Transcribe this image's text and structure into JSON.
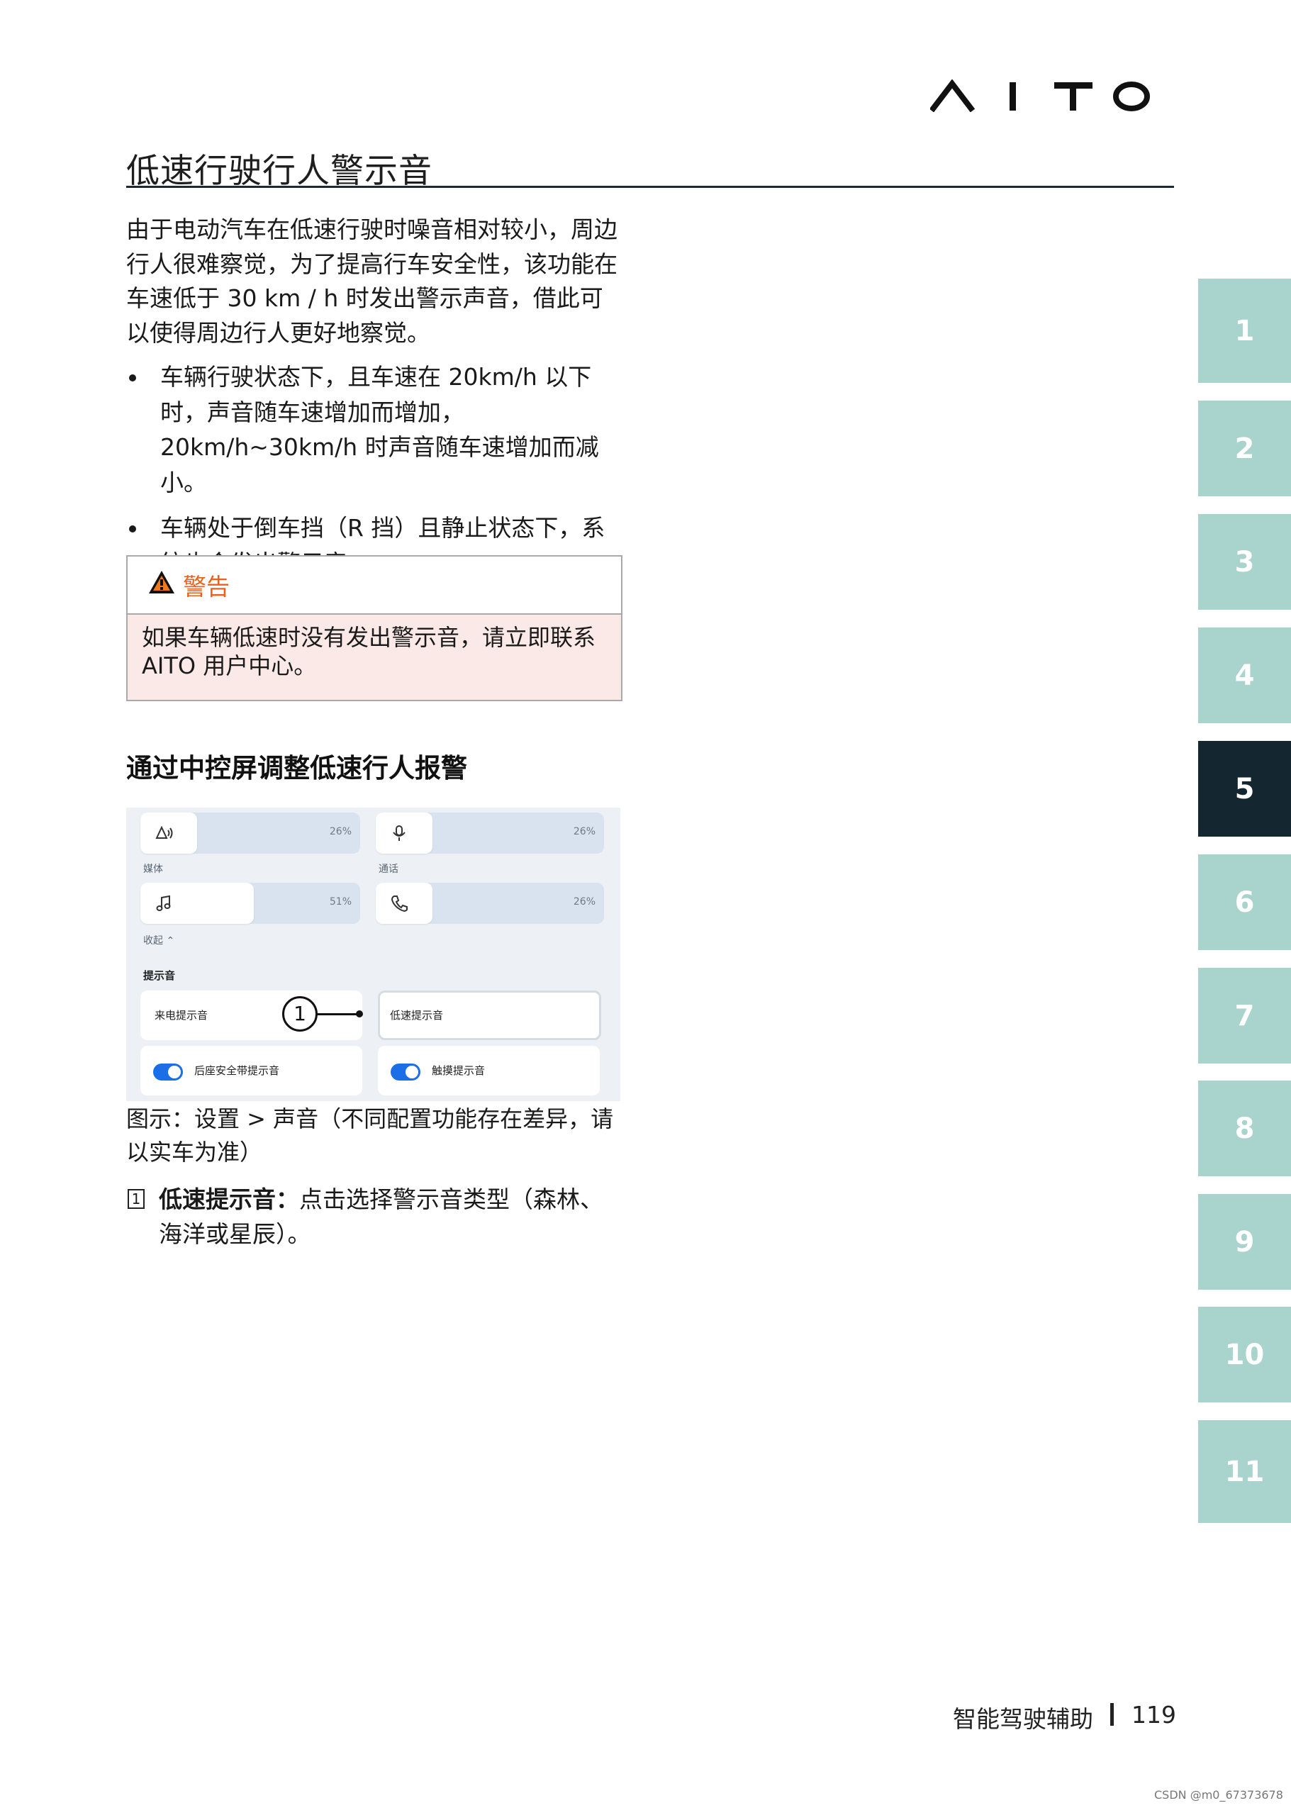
{
  "header": {
    "logo_text": "AITO",
    "title": "低速行驶行人警示音"
  },
  "intro": "由于电动汽车在低速行驶时噪音相对较小，周边行人很难察觉，为了提高行车安全性，该功能在车速低于 30 km / h 时发出警示声音，借此可以使得周边行人更好地察觉。",
  "bullets": [
    "车辆行驶状态下，且车速在 20km/h 以下时，声音随车速增加而增加，20km/h~30km/h 时声音随车速增加而减小。",
    "车辆处于倒车挡（R 挡）且静止状态下，系统也会发出警示音。"
  ],
  "warning": {
    "icon": "warning-triangle-icon",
    "title": "警告",
    "body": "如果车辆低速时没有发出警示音，请立即联系 AITO 用户中心。"
  },
  "subheading": "通过中控屏调整低速行人报警",
  "screenshot": {
    "sliders": [
      {
        "icon": "speaker-icon",
        "value": "26%"
      },
      {
        "icon": "microphone-icon",
        "value": "26%"
      },
      {
        "icon": "music-note-icon",
        "value": "51%"
      },
      {
        "icon": "phone-icon",
        "value": "26%"
      }
    ],
    "slider_fill": [
      0.26,
      0.26,
      0.51,
      0.26
    ],
    "label_media": "媒体",
    "label_call": "通话",
    "collapse": "收起",
    "section": "提示音",
    "card_incoming": "来电提示音",
    "card_lowspeed": "低速提示音",
    "toggle_rear_belt": "后座安全带提示音",
    "toggle_touch": "触摸提示音",
    "callout": "1"
  },
  "caption": "图示：设置 > 声音（不同配置功能存在差异，请以实车为准）",
  "numbered": {
    "num": "1",
    "term": "低速提示音：",
    "text": "点击选择警示音类型（森林、海洋或星辰）。"
  },
  "tabs": [
    "1",
    "2",
    "3",
    "4",
    "5",
    "6",
    "7",
    "8",
    "9",
    "10",
    "11"
  ],
  "active_tab": "5",
  "colors": {
    "tab": "#a9d3cd",
    "tab_active": "#14262f",
    "warning_orange": "#e9621c"
  },
  "footer": {
    "section": "智能驾驶辅助",
    "page": "119"
  },
  "watermark": "CSDN @m0_67373678"
}
